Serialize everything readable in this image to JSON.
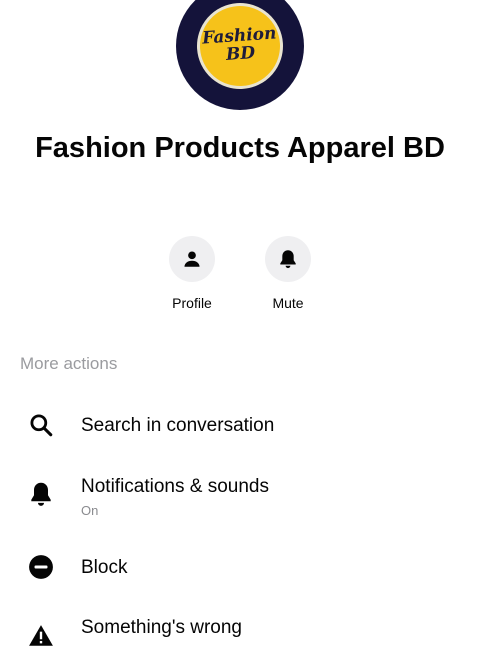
{
  "header": {
    "avatar_text_line1": "Fashion",
    "avatar_text_line2": "BD",
    "title": "Fashion Products Apparel BD"
  },
  "quick_actions": [
    {
      "label": "Profile",
      "icon": "person-icon"
    },
    {
      "label": "Mute",
      "icon": "bell-icon"
    }
  ],
  "more_actions": {
    "title": "More actions",
    "items": [
      {
        "label": "Search in conversation",
        "icon": "search-icon"
      },
      {
        "label": "Notifications & sounds",
        "sub": "On",
        "icon": "bell-icon"
      },
      {
        "label": "Block",
        "icon": "block-icon"
      },
      {
        "label": "Something's wrong",
        "icon": "warning-icon"
      }
    ]
  }
}
